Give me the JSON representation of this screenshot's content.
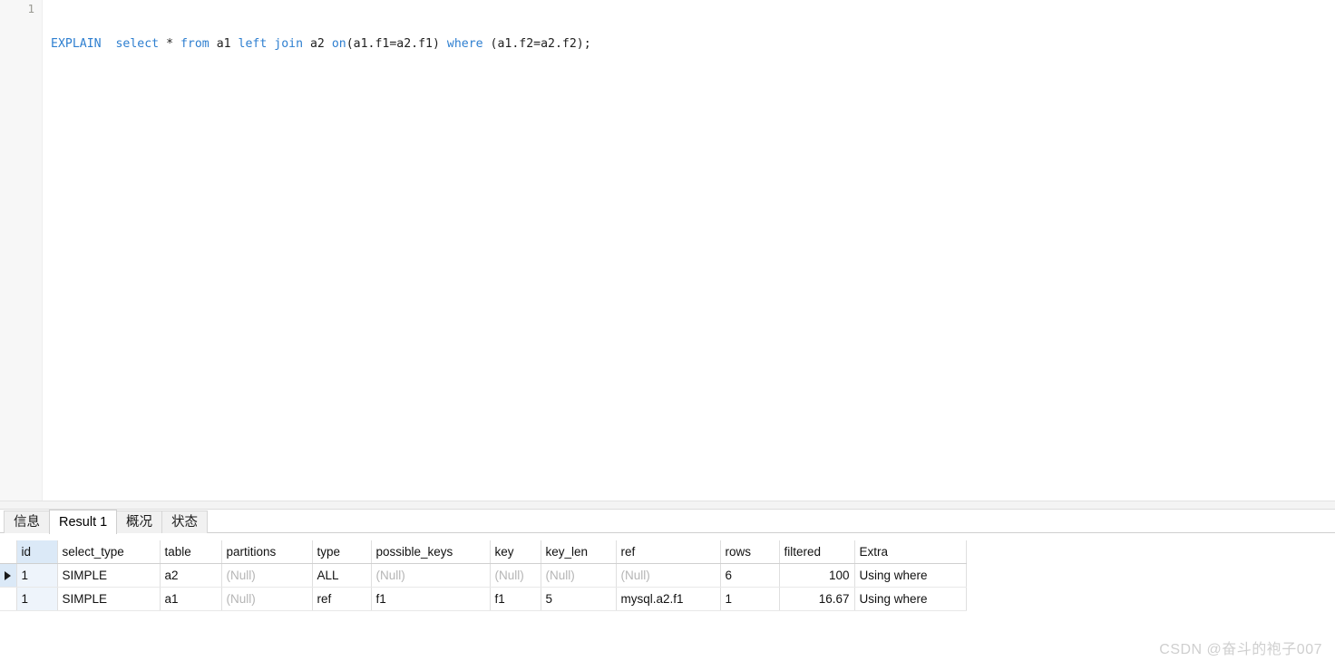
{
  "editor": {
    "line_numbers": [
      "1"
    ],
    "sql_tokens": [
      {
        "t": "EXPLAIN",
        "c": "kw"
      },
      {
        "t": "  ",
        "c": "plain"
      },
      {
        "t": "select",
        "c": "kw"
      },
      {
        "t": " ",
        "c": "plain"
      },
      {
        "t": "*",
        "c": "op"
      },
      {
        "t": " ",
        "c": "plain"
      },
      {
        "t": "from",
        "c": "kw"
      },
      {
        "t": " ",
        "c": "plain"
      },
      {
        "t": "a1",
        "c": "ident"
      },
      {
        "t": " ",
        "c": "plain"
      },
      {
        "t": "left",
        "c": "kw"
      },
      {
        "t": " ",
        "c": "plain"
      },
      {
        "t": "join",
        "c": "kw"
      },
      {
        "t": " ",
        "c": "plain"
      },
      {
        "t": "a2",
        "c": "ident"
      },
      {
        "t": " ",
        "c": "plain"
      },
      {
        "t": "on",
        "c": "kwfn"
      },
      {
        "t": "(a1.f1=a2.f1)",
        "c": "ident"
      },
      {
        "t": " ",
        "c": "plain"
      },
      {
        "t": "where",
        "c": "kw"
      },
      {
        "t": " ",
        "c": "plain"
      },
      {
        "t": "(a1.f2=a2.f2);",
        "c": "ident"
      }
    ],
    "sql_plain": "EXPLAIN  select * from a1 left join a2 on(a1.f1=a2.f1) where (a1.f2=a2.f2);"
  },
  "result_tabs": [
    {
      "label": "信息",
      "selected": false
    },
    {
      "label": "Result 1",
      "selected": true
    },
    {
      "label": "概况",
      "selected": false
    },
    {
      "label": "状态",
      "selected": false
    }
  ],
  "grid": {
    "columns": [
      {
        "key": "id",
        "label": "id",
        "width": 45,
        "highlight": true,
        "align": "left"
      },
      {
        "key": "select_type",
        "label": "select_type",
        "width": 113,
        "highlight": false,
        "align": "left"
      },
      {
        "key": "table",
        "label": "table",
        "width": 68,
        "highlight": false,
        "align": "left"
      },
      {
        "key": "partitions",
        "label": "partitions",
        "width": 100,
        "highlight": false,
        "align": "left"
      },
      {
        "key": "type",
        "label": "type",
        "width": 65,
        "highlight": false,
        "align": "left"
      },
      {
        "key": "possible_keys",
        "label": "possible_keys",
        "width": 131,
        "highlight": false,
        "align": "left"
      },
      {
        "key": "key",
        "label": "key",
        "width": 56,
        "highlight": false,
        "align": "left"
      },
      {
        "key": "key_len",
        "label": "key_len",
        "width": 83,
        "highlight": false,
        "align": "left"
      },
      {
        "key": "ref",
        "label": "ref",
        "width": 115,
        "highlight": false,
        "align": "left"
      },
      {
        "key": "rows",
        "label": "rows",
        "width": 65,
        "highlight": false,
        "align": "left"
      },
      {
        "key": "filtered",
        "label": "filtered",
        "width": 83,
        "highlight": false,
        "align": "right"
      },
      {
        "key": "Extra",
        "label": "Extra",
        "width": 123,
        "highlight": false,
        "align": "left"
      }
    ],
    "null_text": "(Null)",
    "rows": [
      {
        "current": true,
        "cells": {
          "id": "1",
          "select_type": "SIMPLE",
          "table": "a2",
          "partitions": null,
          "type": "ALL",
          "possible_keys": null,
          "key": null,
          "key_len": null,
          "ref": null,
          "rows": "6",
          "filtered": "100",
          "Extra": "Using where"
        }
      },
      {
        "current": false,
        "cells": {
          "id": "1",
          "select_type": "SIMPLE",
          "table": "a1",
          "partitions": null,
          "type": "ref",
          "possible_keys": "f1",
          "key": "f1",
          "key_len": "5",
          "ref": "mysql.a2.f1",
          "rows": "1",
          "filtered": "16.67",
          "Extra": "Using where"
        }
      }
    ]
  },
  "watermark": {
    "text": "CSDN @奋斗的袍子007"
  },
  "colors": {
    "keyword": "#2e7fd0",
    "identifier": "#212121",
    "null": "#b5b5b5",
    "header_highlight": "#dbe9f7",
    "cell_highlight": "#eef4fb",
    "gutter_bg": "#f7f7f7",
    "splitter_bg": "#f4f4f4",
    "watermark": "#cfcfcf"
  }
}
